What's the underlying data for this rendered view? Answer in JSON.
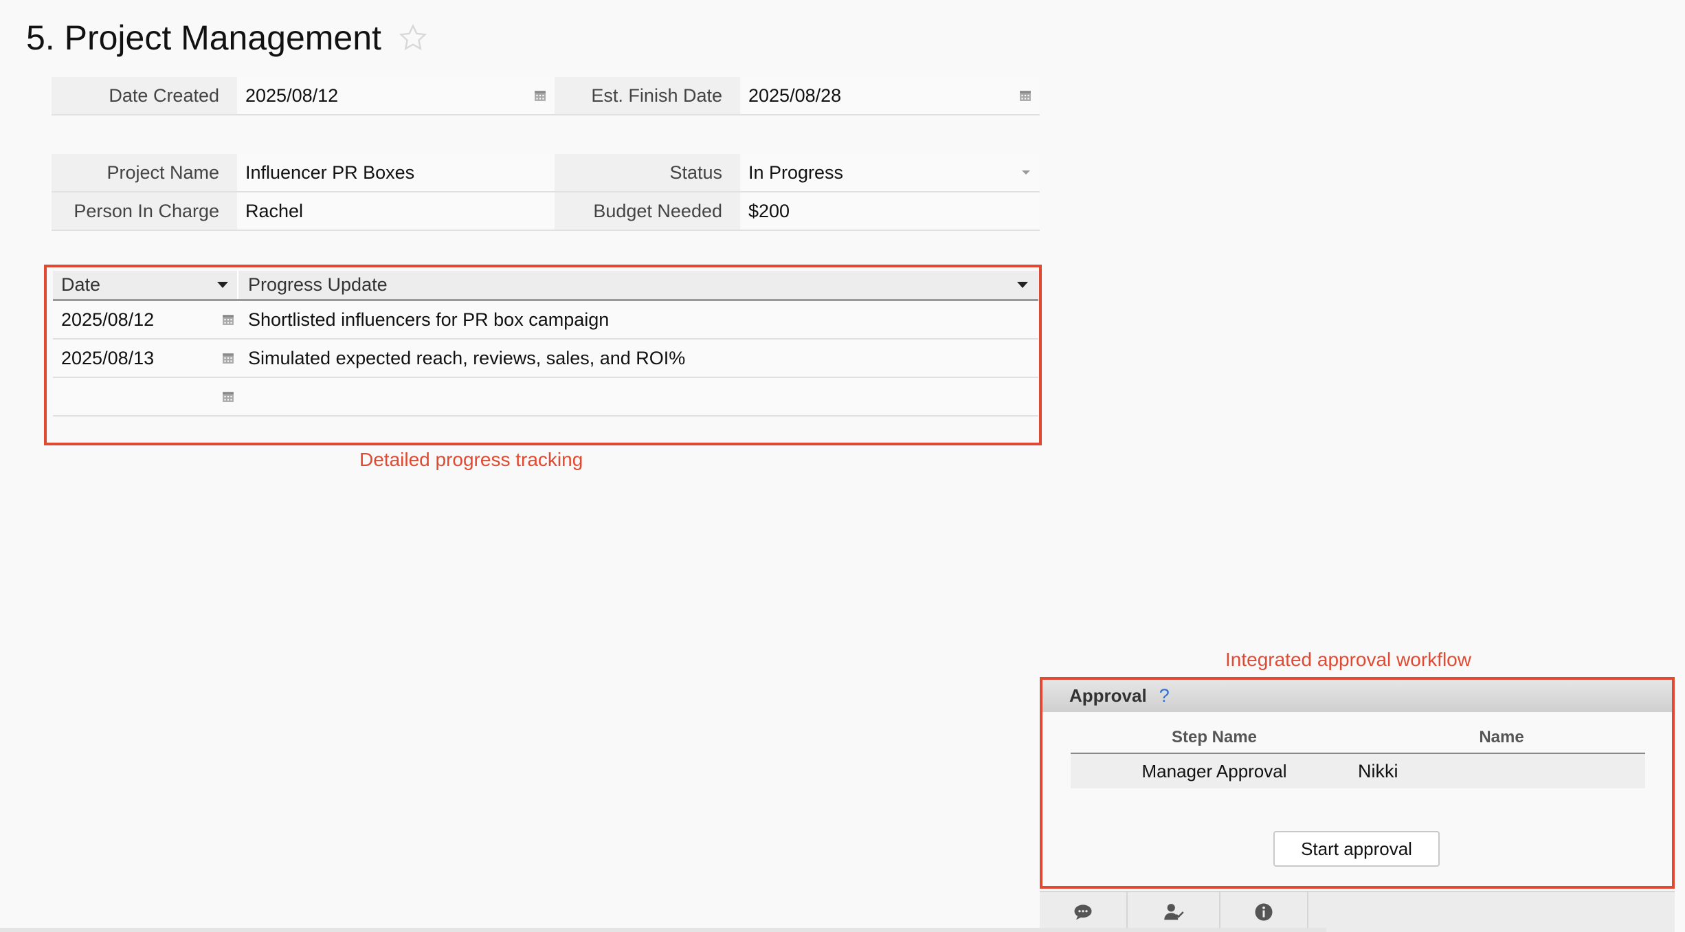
{
  "page": {
    "title": "5. Project Management"
  },
  "dates": {
    "created_label": "Date Created",
    "created_value": "2025/08/12",
    "finish_label": "Est. Finish Date",
    "finish_value": "2025/08/28"
  },
  "project": {
    "name_label": "Project Name",
    "name_value": "Influencer PR Boxes",
    "status_label": "Status",
    "status_value": "In Progress",
    "person_label": "Person In Charge",
    "person_value": "Rachel",
    "budget_label": "Budget Needed",
    "budget_value": "$200"
  },
  "progress": {
    "columns": [
      "Date",
      "Progress Update"
    ],
    "rows": [
      {
        "date": "2025/08/12",
        "update": "Shortlisted influencers for PR box campaign"
      },
      {
        "date": "2025/08/13",
        "update": "Simulated expected reach, reviews, sales, and ROI%"
      },
      {
        "date": "",
        "update": ""
      }
    ],
    "annotation": "Detailed progress tracking"
  },
  "approval": {
    "annotation": "Integrated approval workflow",
    "title": "Approval",
    "help": "?",
    "columns": [
      "Step Name",
      "Name"
    ],
    "rows": [
      {
        "step": "Manager Approval",
        "name": "Nikki"
      }
    ],
    "start_button": "Start approval"
  },
  "toolbar": {
    "icons": [
      "comment-icon",
      "user-check-icon",
      "info-icon"
    ]
  },
  "colors": {
    "annotation": "#e04a32",
    "help": "#2f6fd6"
  }
}
